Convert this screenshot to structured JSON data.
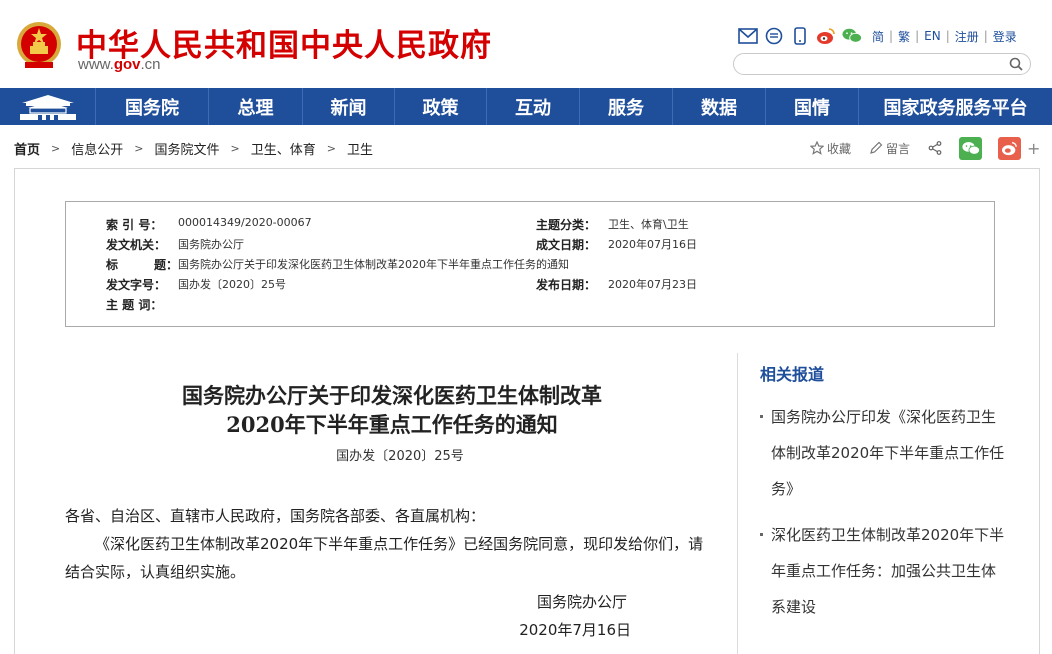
{
  "header": {
    "site_title": "中华人民共和国中央人民政府",
    "url_prefix": "www.",
    "url_accent": "gov",
    "url_suffix": ".cn",
    "lang_simplified": "简",
    "lang_traditional": "繁",
    "lang_english": "EN",
    "register": "注册",
    "login": "登录",
    "search_placeholder": ""
  },
  "nav": {
    "items": [
      "国务院",
      "总理",
      "新闻",
      "政策",
      "互动",
      "服务",
      "数据",
      "国情",
      "国家政务服务平台"
    ]
  },
  "breadcrumb": {
    "items": [
      "首页",
      "信息公开",
      "国务院文件",
      "卫生、体育",
      "卫生"
    ],
    "separator": ">"
  },
  "share": {
    "favorite": "收藏",
    "comment": "留言"
  },
  "meta": {
    "index_label": "索 引 号：",
    "index_value": "000014349/2020-00067",
    "topic_label": "主题分类：",
    "topic_value": "卫生、体育\\卫生",
    "issuer_label": "发文机关：",
    "issuer_value": "国务院办公厅",
    "created_label": "成文日期：",
    "created_value": "2020年07月16日",
    "title_label_a": "标",
    "title_label_b": "题：",
    "title_value": "国务院办公厅关于印发深化医药卫生体制改革2020年下半年重点工作任务的通知",
    "docno_label": "发文字号：",
    "docno_value": "国办发〔2020〕25号",
    "published_label": "发布日期：",
    "published_value": "2020年07月23日",
    "keywords_label": "主 题 词："
  },
  "article": {
    "title_line1": "国务院办公厅关于印发深化医药卫生体制改革",
    "title_line2": "2020年下半年重点工作任务的通知",
    "doc_number": "国办发〔2020〕25号",
    "salutation": "各省、自治区、直辖市人民政府，国务院各部委、各直属机构：",
    "body": "《深化医药卫生体制改革2020年下半年重点工作任务》已经国务院同意，现印发给你们，请结合实际，认真组织实施。",
    "signature": "国务院办公厅",
    "date": "2020年7月16日"
  },
  "related": {
    "title": "相关报道",
    "items": [
      "国务院办公厅印发《深化医药卫生体制改革2020年下半年重点工作任务》",
      "深化医药卫生体制改革2020年下半年重点工作任务：加强公共卫生体系建设"
    ]
  },
  "colors": {
    "brand_red": "#d40000",
    "nav_blue": "#1f4e9a",
    "wechat_green": "#4caf50",
    "weibo_red": "#e8604c"
  }
}
